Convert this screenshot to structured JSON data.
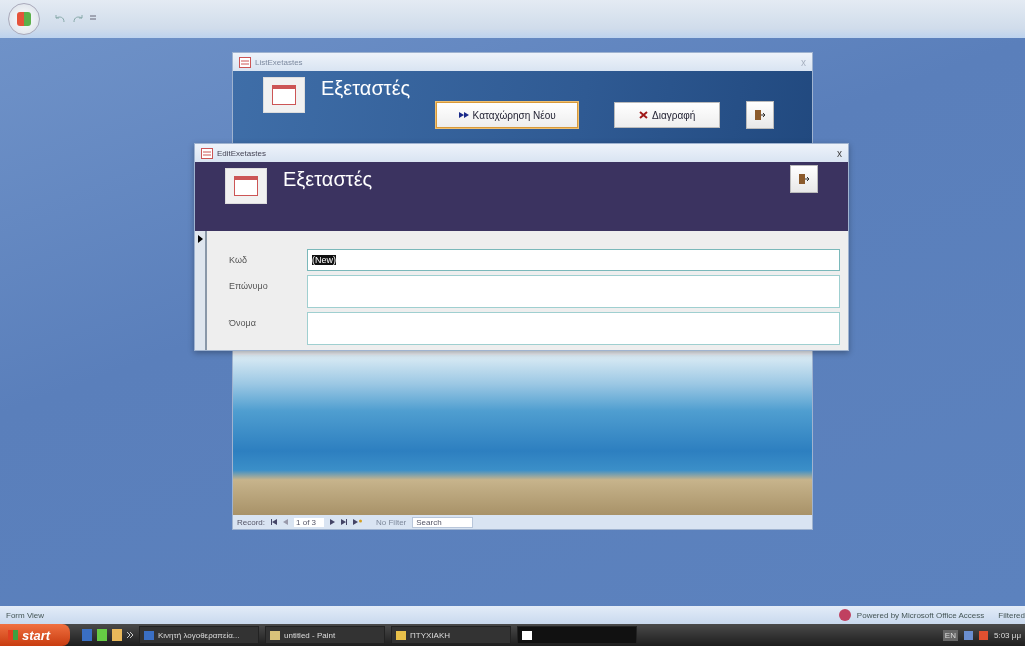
{
  "back_window": {
    "title": "ListExetastes",
    "heading": "Εξεταστές",
    "buttons": [
      {
        "label": "Καταχώρηση Νέου",
        "kind": "new"
      },
      {
        "label": "Διαγραφή",
        "kind": "delete"
      }
    ],
    "close": "x",
    "navigation": {
      "label": "Record:",
      "position": "1 of 3",
      "filter": "No Filter",
      "search": "Search"
    }
  },
  "front_window": {
    "title": "EditExetastes",
    "heading": "Εξεταστές",
    "close": "x",
    "fields": [
      {
        "label": "Κωδ",
        "value": "(New)",
        "selected": true
      },
      {
        "label": "Επώνυμο",
        "selected": false
      },
      {
        "label": "Όνομα",
        "selected": false
      }
    ]
  },
  "status_bar": {
    "view": "Form View",
    "powered_by": "Powered by Microsoft Office Access",
    "filter_state": "Filtered"
  },
  "taskbar": {
    "start": "start",
    "tasks": [
      {
        "label": "Κινητή λογοθεραπεία...",
        "kind": "word"
      },
      {
        "label": "untitled - Paint",
        "kind": "paint"
      },
      {
        "label": "ΠΤΥΧΙΑΚΗ",
        "kind": "folder"
      },
      {
        "kind": "blank"
      }
    ],
    "language": "EN",
    "clock": "5:03 μμ"
  }
}
